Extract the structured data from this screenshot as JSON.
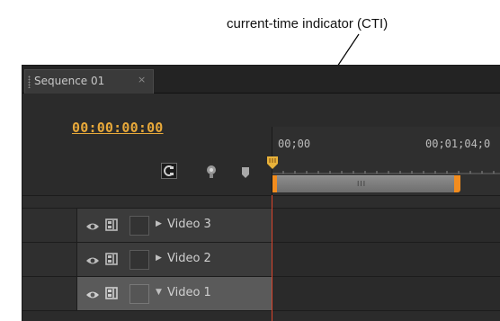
{
  "annotation": {
    "label": "current-time indicator (CTI)"
  },
  "panel": {
    "tab_label": "Sequence 01",
    "tab_close": "×",
    "timecode": "00:00:00:00",
    "ruler": {
      "start_label": "00;00",
      "mid_label": "00;01;04;0"
    },
    "workbar_grip": "III",
    "tools": [
      "snap-icon",
      "add-marker-icon",
      "flag-icon"
    ]
  },
  "tracks": [
    {
      "name": "Video 3",
      "expander": "▶",
      "selected": false
    },
    {
      "name": "Video 2",
      "expander": "▶",
      "selected": false
    },
    {
      "name": "Video 1",
      "expander": "▼",
      "selected": true
    }
  ],
  "colors": {
    "timecode": "#e8a93a",
    "cti": "#d9442b",
    "work_area_handle": "#f28c1e",
    "panel_bg": "#2b2b2b"
  }
}
